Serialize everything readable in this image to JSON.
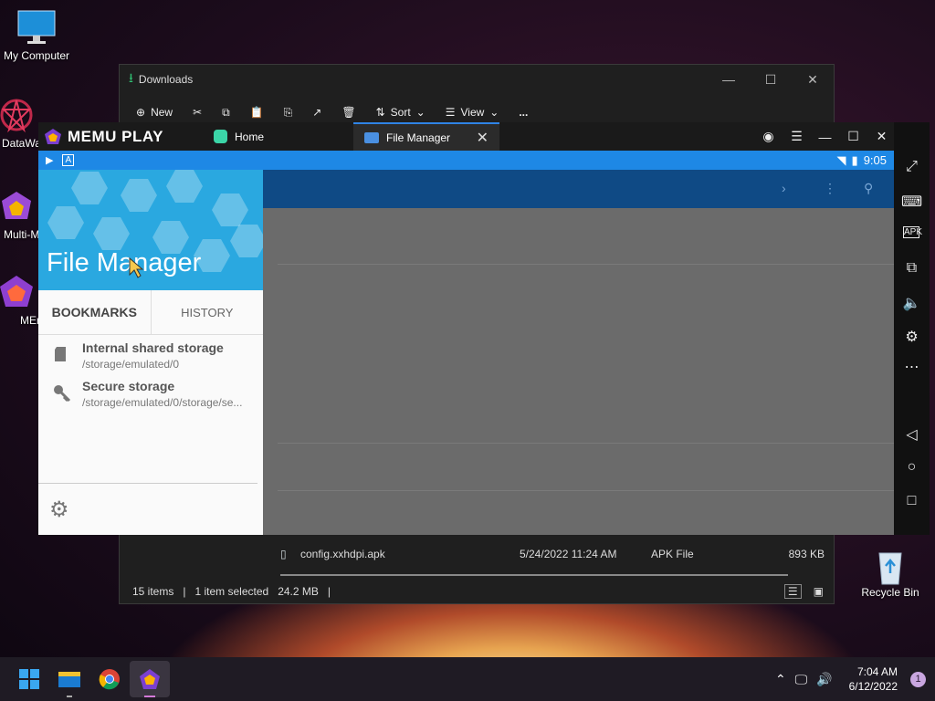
{
  "desktop": {
    "icons": [
      {
        "label": "My Computer"
      },
      {
        "label": "DataWa"
      },
      {
        "label": "Multi-M"
      },
      {
        "label": "MEr"
      },
      {
        "label": "Recycle Bin"
      }
    ]
  },
  "explorer": {
    "title": "Downloads",
    "toolbar": {
      "new": "New",
      "sort": "Sort",
      "view": "View",
      "more": "..."
    },
    "file_row": {
      "name": "config.xxhdpi.apk",
      "date": "5/24/2022 11:24 AM",
      "type": "APK File",
      "size": "893 KB"
    },
    "status": {
      "items": "15 items",
      "selected": "1 item selected",
      "size": "24.2 MB"
    }
  },
  "memu": {
    "logo": "MEMU PLAY",
    "tabs": [
      {
        "label": "Home"
      },
      {
        "label": "File Manager"
      }
    ],
    "android": {
      "time": "9:05",
      "drawer": {
        "title": "File Manager",
        "tabs": [
          "BOOKMARKS",
          "HISTORY"
        ],
        "items": [
          {
            "name": "Internal shared storage",
            "path": "/storage/emulated/0"
          },
          {
            "name": "Secure storage",
            "path": "/storage/emulated/0/storage/se..."
          }
        ]
      }
    }
  },
  "taskbar": {
    "time": "7:04 AM",
    "date": "6/12/2022",
    "badge": "1"
  },
  "colors": {
    "accent": "#1e88e5",
    "appbar": "#0f4a85",
    "drawer_hero": "#2aa8e0"
  }
}
